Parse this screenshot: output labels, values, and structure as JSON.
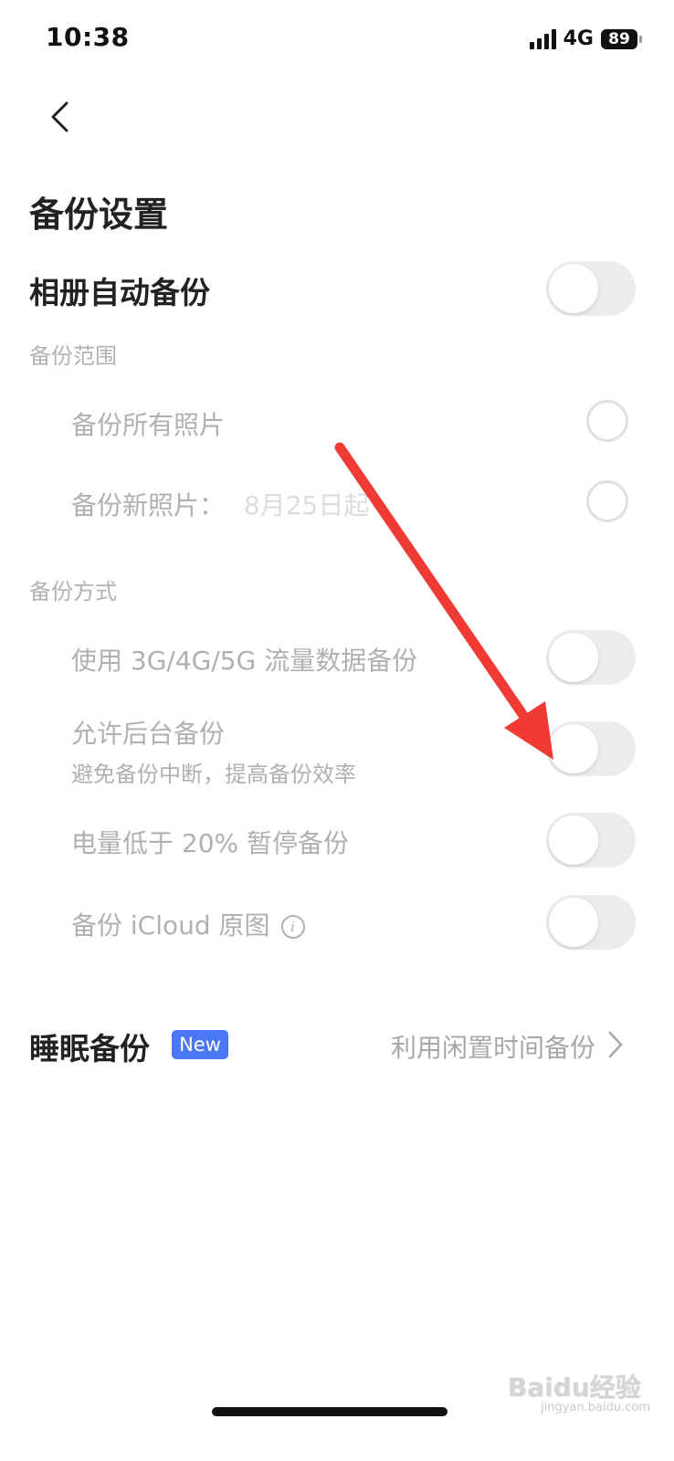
{
  "status_bar": {
    "time": "10:38",
    "network": "4G",
    "battery": "89"
  },
  "header": {
    "title": "备份设置"
  },
  "album_backup": {
    "label": "相册自动备份",
    "enabled": false
  },
  "backup_range": {
    "section_label": "备份范围",
    "all_photos_label": "备份所有照片",
    "new_photos_label": "备份新照片：",
    "new_photos_date": "8月25日起"
  },
  "backup_method": {
    "section_label": "备份方式",
    "mobile_data_label": "使用 3G/4G/5G 流量数据备份",
    "background_label": "允许后台备份",
    "background_sub": "避免备份中断，提高备份效率",
    "low_battery_label": "电量低于 20% 暂停备份",
    "icloud_label": "备份 iCloud 原图"
  },
  "sleep_backup": {
    "label": "睡眠备份",
    "badge": "New",
    "hint": "利用闲置时间备份"
  },
  "watermark": {
    "brand": "Baidu经验",
    "site": "jingyan.baidu.com"
  },
  "colors": {
    "annotation_arrow": "#f03b35",
    "badge": "#4a77f5",
    "toggle_off": "#ececef"
  }
}
